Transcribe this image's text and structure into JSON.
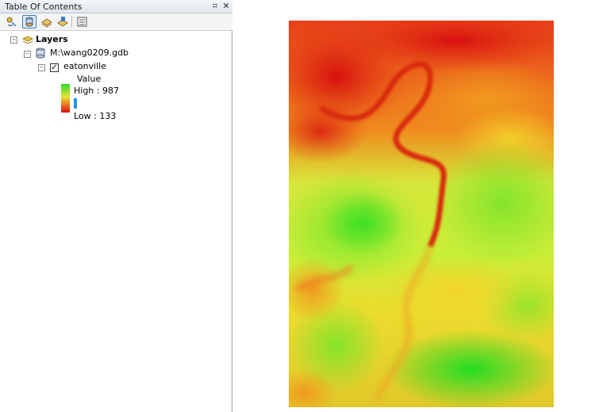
{
  "toc": {
    "title": "Table Of Contents",
    "pin_icon": "pin-icon",
    "close_icon": "close-icon",
    "toolbar": [
      "list-by-drawing-order-icon",
      "list-by-source-icon",
      "list-by-visibility-icon",
      "list-by-selection-icon",
      "options-icon"
    ],
    "tree": {
      "root_label": "Layers",
      "database_label": "M:\\wang0209.gdb",
      "layer_label": "eatonville",
      "layer_checked": true,
      "legend_heading": "Value",
      "high_label": "High : 987",
      "low_label": "Low : 133"
    }
  },
  "colors": {
    "high": "#2cd92c",
    "mid": "#e6e23a",
    "low": "#d41010"
  }
}
